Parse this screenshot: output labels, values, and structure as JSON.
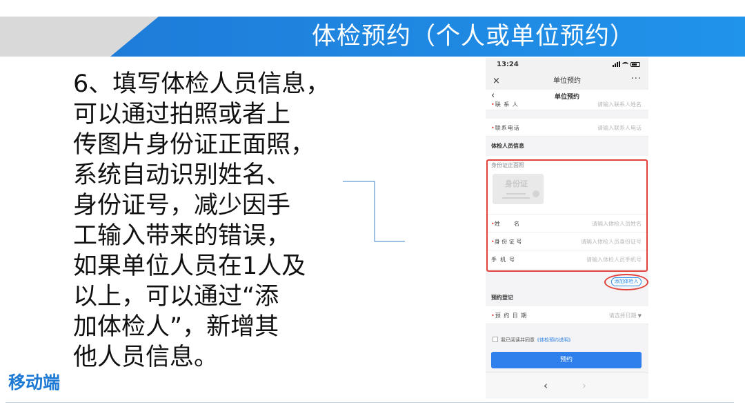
{
  "slide": {
    "title": "体检预约（个人或单位预约）",
    "corner_label": "移动端",
    "description_lines": [
      "6、填写体检人员信息，",
      "可以通过拍照或者上",
      "传图片身份证正面照，",
      "系统自动识别姓名、",
      "身份证号，减少因手",
      "工输入带来的错误，",
      "如果单位人员在1人及",
      "以上，可以通过“添",
      "加体检人”，新增其",
      "他人员信息。"
    ],
    "colors": {
      "banner_blue": "#1f86e0",
      "banner_gray": "#d9d9d9",
      "label_blue": "#1c79d4",
      "highlight_red": "#e0413a"
    }
  },
  "phone": {
    "status_time": "13:24",
    "app_title": "单位预约",
    "close_icon": "×",
    "more_icon": "···",
    "page_title": "单位预约",
    "back_icon": "‹",
    "contact_partial": {
      "label": "联 系 人",
      "placeholder": "请输入联系人姓名"
    },
    "contact_phone": {
      "label": "联系电话",
      "placeholder": "请输入联系人电话"
    },
    "section_examinee": "体检人员信息",
    "id_photo_caption": "身份证正面照",
    "id_card_text": "身份证",
    "name_field": {
      "label": "姓        名",
      "placeholder": "请输入体检人员姓名"
    },
    "id_field": {
      "label": "身 份 证 号",
      "placeholder": "请输入体检人员身份证号"
    },
    "mobile_field": {
      "label": "手  机  号",
      "placeholder": "请输入体检人员手机号"
    },
    "add_button": "添加体检人",
    "section_booking": "预约登记",
    "date_field": {
      "label": "预 约 日 期",
      "placeholder": "请选择日期"
    },
    "agree_prefix": "我已阅读并同意",
    "agree_link": "《体检预约说明》",
    "submit_label": "预约",
    "nav_prev": "‹",
    "nav_next": "›",
    "required_mark": "•"
  }
}
